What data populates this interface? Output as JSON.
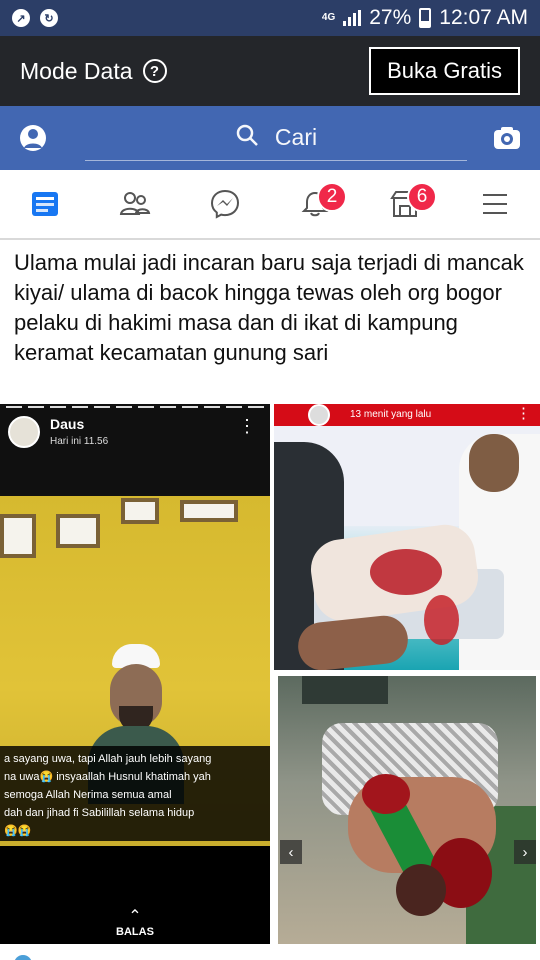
{
  "status_bar": {
    "network": "4G",
    "battery": "27%",
    "time": "12:07 AM"
  },
  "data_bar": {
    "title": "Mode Data",
    "button": "Buka Gratis"
  },
  "search": {
    "placeholder": "Cari"
  },
  "nav": {
    "notifications_badge": "2",
    "marketplace_badge": "6"
  },
  "post": {
    "text": "Ulama mulai jadi incaran  baru saja terjadi di mancak kiyai/ ulama di bacok hingga tewas oleh org bogor pelaku di hakimi masa dan di ikat di kampung keramat kecamatan gunung sari",
    "story": {
      "name": "Daus",
      "time": "Hari ini 11.56",
      "caption": "a sayang uwa, tapi Allah jauh lebih sayang\nna uwa😭 insyaallah Husnul khatimah yah\nsemoga Allah Nerima semua amal\ndah dan jihad fi Sabilillah selama hidup\n😭😭",
      "reply": "BALAS"
    },
    "right_top_timestamp": "13 menit yang lalu"
  },
  "colors": {
    "facebook_blue": "#4267b2",
    "status_bar": "#2c3e67",
    "data_bar": "#24262a",
    "badge_red": "#f02849"
  }
}
